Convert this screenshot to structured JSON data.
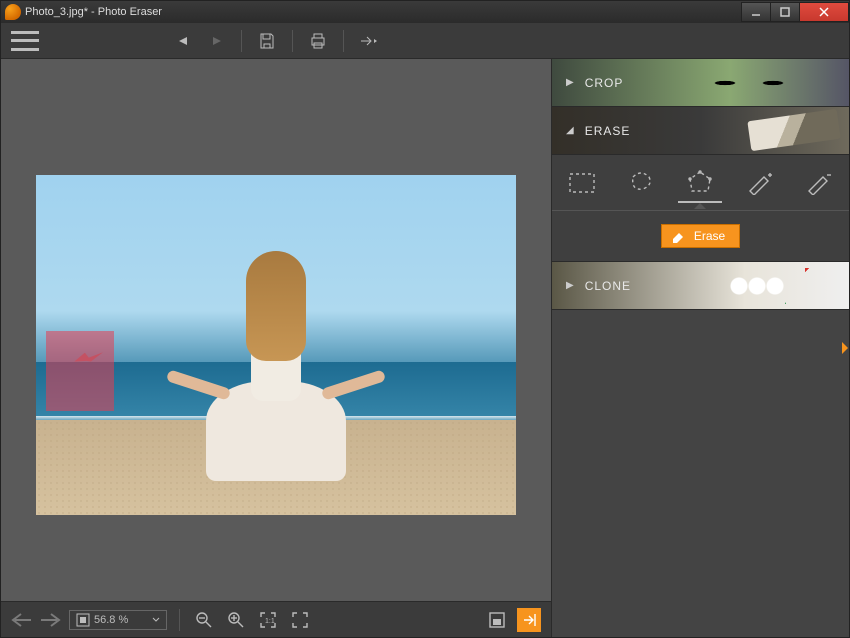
{
  "window": {
    "title": "Photo_3.jpg* - Photo Eraser"
  },
  "toolbar": {
    "undo_name": "undo",
    "redo_name": "redo",
    "save_name": "save",
    "print_name": "print",
    "export_name": "export"
  },
  "rightpanel": {
    "crop_label": "CROP",
    "erase_label": "ERASE",
    "clone_label": "CLONE",
    "erase_button_label": "Erase",
    "tools": {
      "rect": "rectangle-select",
      "lasso": "lasso-select",
      "polygon": "polygon-select",
      "brush_add": "brush-add",
      "brush_remove": "brush-remove"
    }
  },
  "statusbar": {
    "zoom_value": "56.8 %"
  }
}
